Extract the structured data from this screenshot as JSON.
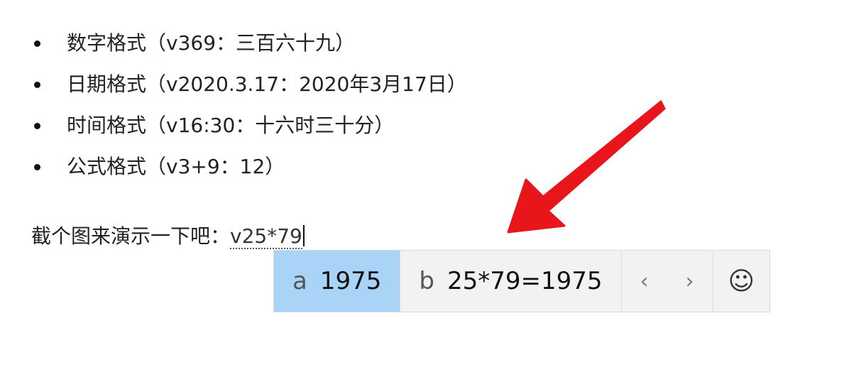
{
  "bullets": [
    {
      "label": "数字格式（v369：三百六十九）"
    },
    {
      "label": "日期格式（v2020.3.17：2020年3月17日）"
    },
    {
      "label": "时间格式（v16:30：十六时三十分）"
    },
    {
      "label": "公式格式（v3+9：12）"
    }
  ],
  "demo": {
    "prompt": "截个图来演示一下吧：",
    "typed": "v25*79"
  },
  "ime": {
    "candidates": [
      {
        "key": "a",
        "text": "1975"
      },
      {
        "key": "b",
        "text": "25*79=1975"
      }
    ],
    "prev_icon": "‹",
    "next_icon": "›",
    "emoji_icon": "☺"
  },
  "colors": {
    "selected_candidate": "#a9d3f7",
    "arrow": "#e8161b"
  }
}
